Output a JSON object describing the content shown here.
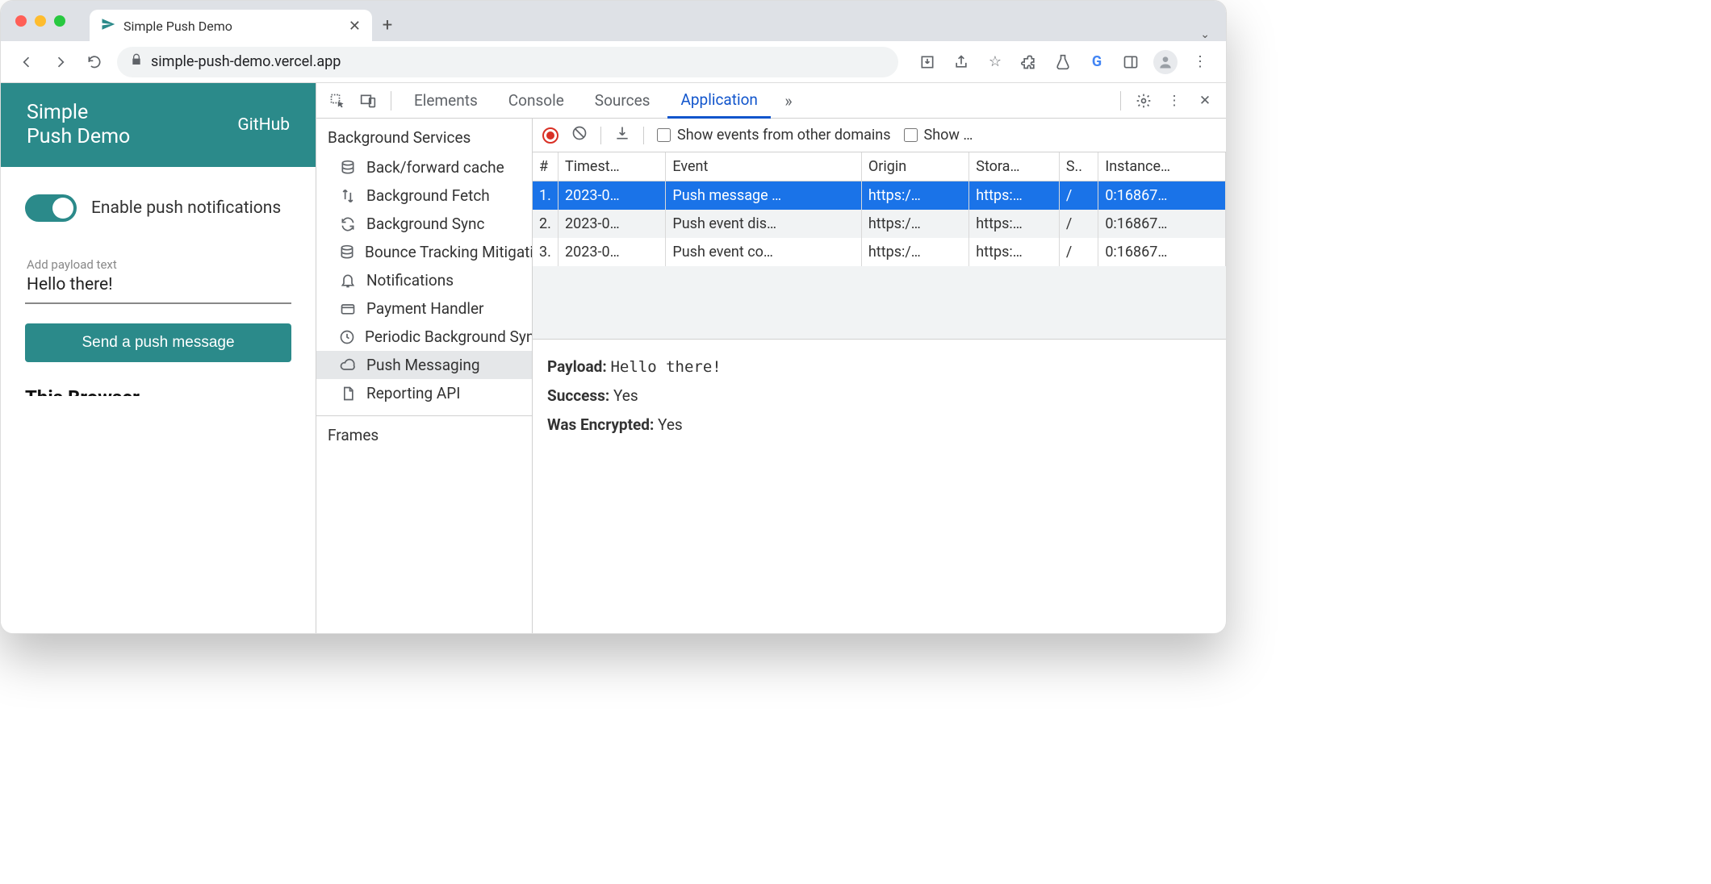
{
  "browser": {
    "tab_title": "Simple Push Demo",
    "url_display": "simple-push-demo.vercel.app",
    "newtab": "+"
  },
  "app": {
    "title_line1": "Simple",
    "title_line2": "Push Demo",
    "github": "GitHub",
    "toggle_label": "Enable push notifications",
    "payload_placeholder": "Add payload text",
    "payload_value": "Hello there!",
    "send_button": "Send a push message",
    "truncated_heading": "This Browser"
  },
  "devtools": {
    "tabs": [
      "Elements",
      "Console",
      "Sources",
      "Application"
    ],
    "more_tabs_glyph": "»",
    "sidebar": {
      "section1": "Background Services",
      "items": [
        {
          "label": "Back/forward cache"
        },
        {
          "label": "Background Fetch"
        },
        {
          "label": "Background Sync"
        },
        {
          "label": "Bounce Tracking Mitigations"
        },
        {
          "label": "Notifications"
        },
        {
          "label": "Payment Handler"
        },
        {
          "label": "Periodic Background Sync"
        },
        {
          "label": "Push Messaging"
        },
        {
          "label": "Reporting API"
        }
      ],
      "section2": "Frames"
    },
    "toolbar": {
      "cb1_label": "Show events from other domains",
      "cb2_label": "Show …"
    },
    "columns": {
      "n": "#",
      "timestamp": "Timest…",
      "event": "Event",
      "origin": "Origin",
      "storage": "Stora…",
      "s": "S..",
      "instance": "Instance…"
    },
    "rows": [
      {
        "n": "1.",
        "ts": "2023-0…",
        "event": "Push message …",
        "origin": "https:/…",
        "storage": "https:…",
        "s": "/",
        "instance": "0:16867…"
      },
      {
        "n": "2.",
        "ts": "2023-0…",
        "event": "Push event dis…",
        "origin": "https:/…",
        "storage": "https:…",
        "s": "/",
        "instance": "0:16867…"
      },
      {
        "n": "3.",
        "ts": "2023-0…",
        "event": "Push event co…",
        "origin": "https:/…",
        "storage": "https:…",
        "s": "/",
        "instance": "0:16867…"
      }
    ],
    "details": {
      "payload_key": "Payload:",
      "payload_val": "Hello there!",
      "success_key": "Success:",
      "success_val": "Yes",
      "enc_key": "Was Encrypted:",
      "enc_val": "Yes"
    }
  }
}
